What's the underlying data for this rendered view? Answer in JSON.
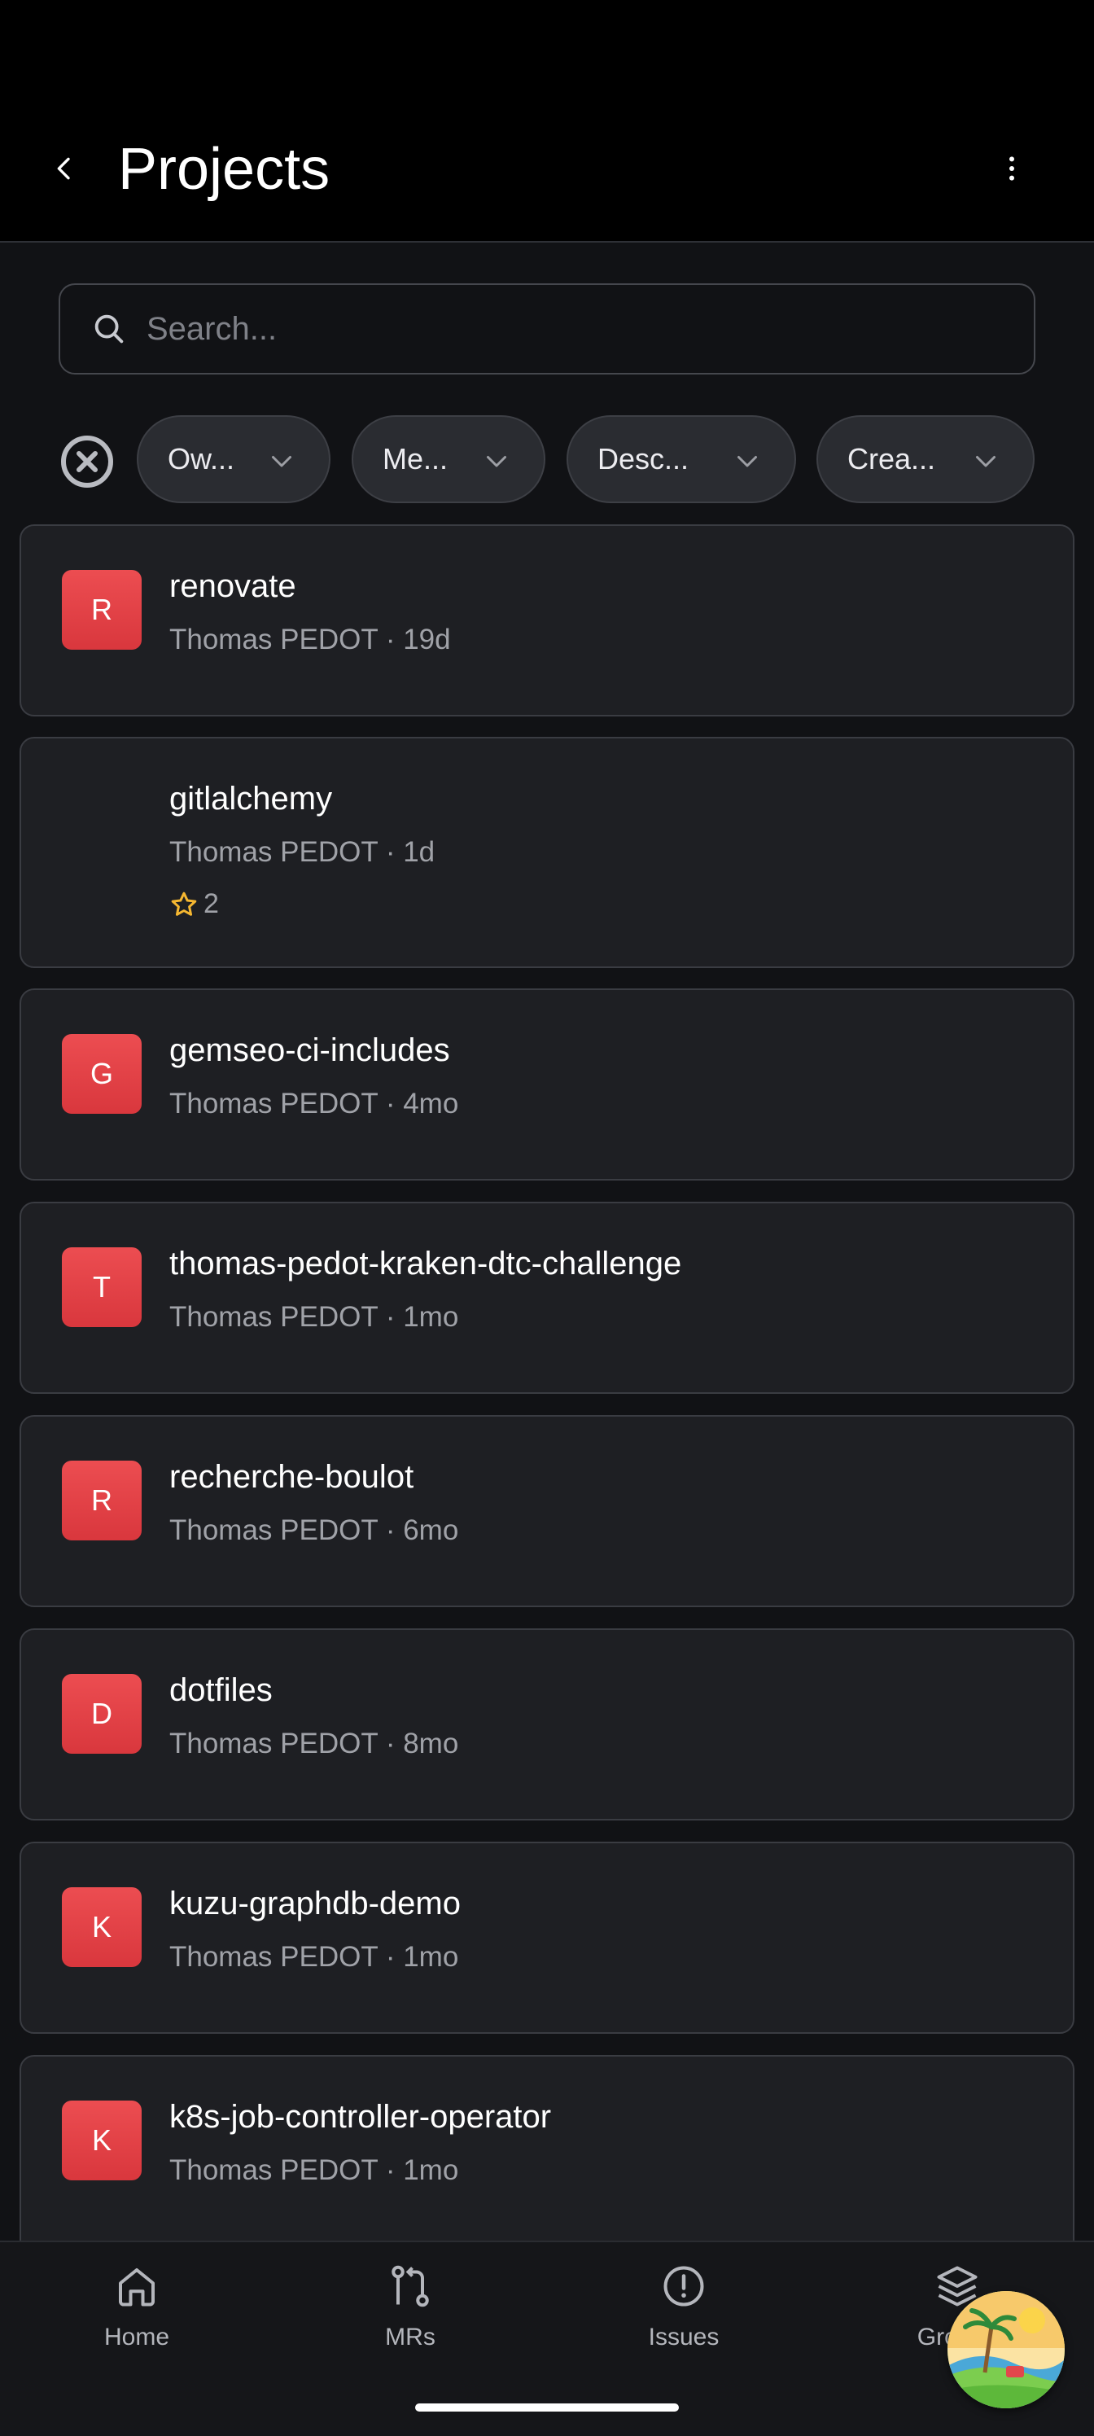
{
  "app": {
    "title": "Projects",
    "accent_color": "#e0444a",
    "star_color": "#f5b731"
  },
  "search": {
    "placeholder": "Search..."
  },
  "filters": {
    "clear_icon": "close-circle-icon",
    "chips": [
      {
        "label": "Ow..."
      },
      {
        "label": "Me..."
      },
      {
        "label": "Desc..."
      },
      {
        "label": "Crea..."
      }
    ]
  },
  "projects": [
    {
      "initial": "R",
      "name": "renovate",
      "meta": "Thomas PEDOT · 19d",
      "has_avatar": true
    },
    {
      "initial": "",
      "name": "gitlalchemy",
      "meta": "Thomas PEDOT · 1d",
      "stars": "2",
      "has_avatar": false
    },
    {
      "initial": "G",
      "name": "gemseo-ci-includes",
      "meta": "Thomas PEDOT · 4mo",
      "has_avatar": true
    },
    {
      "initial": "T",
      "name": "thomas-pedot-kraken-dtc-challenge",
      "meta": "Thomas PEDOT · 1mo",
      "has_avatar": true
    },
    {
      "initial": "R",
      "name": "recherche-boulot",
      "meta": "Thomas PEDOT · 6mo",
      "has_avatar": true
    },
    {
      "initial": "D",
      "name": "dotfiles",
      "meta": "Thomas PEDOT · 8mo",
      "has_avatar": true
    },
    {
      "initial": "K",
      "name": "kuzu-graphdb-demo",
      "meta": "Thomas PEDOT · 1mo",
      "has_avatar": true
    },
    {
      "initial": "K",
      "name": "k8s-job-controller-operator",
      "meta": "Thomas PEDOT · 1mo",
      "has_avatar": true
    }
  ],
  "nav": {
    "items": [
      {
        "label": "Home",
        "icon": "home-icon"
      },
      {
        "label": "MRs",
        "icon": "merge-request-icon"
      },
      {
        "label": "Issues",
        "icon": "issue-icon"
      },
      {
        "label": "Groups",
        "icon": "layers-icon"
      }
    ]
  }
}
